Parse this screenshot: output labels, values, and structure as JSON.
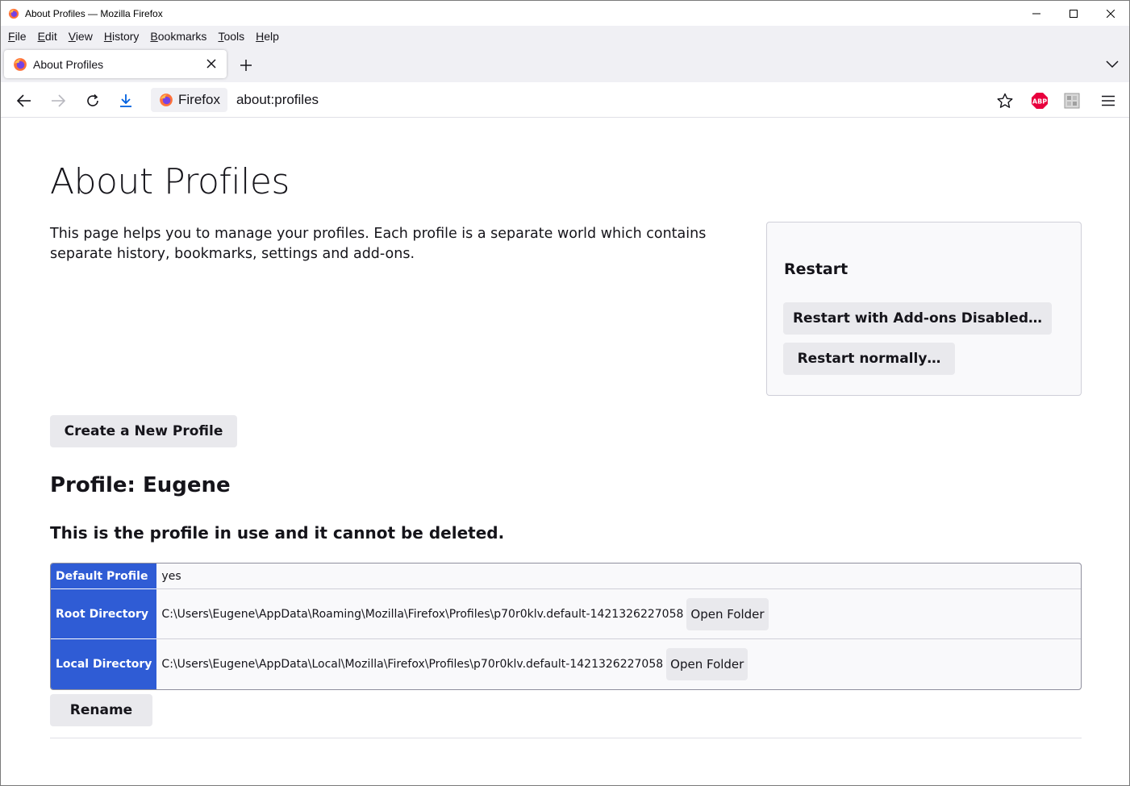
{
  "window": {
    "title": "About Profiles — Mozilla Firefox"
  },
  "menubar": {
    "items": [
      {
        "label": "File",
        "accel": "F",
        "rest": "ile"
      },
      {
        "label": "Edit",
        "accel": "E",
        "rest": "dit"
      },
      {
        "label": "View",
        "accel": "V",
        "rest": "iew"
      },
      {
        "label": "History",
        "accel": "H",
        "rest": "istory"
      },
      {
        "label": "Bookmarks",
        "accel": "B",
        "rest": "ookmarks"
      },
      {
        "label": "Tools",
        "accel": "T",
        "rest": "ools"
      },
      {
        "label": "Help",
        "accel": "H",
        "rest": "elp"
      }
    ]
  },
  "tabs": {
    "active_title": "About Profiles"
  },
  "navbar": {
    "identity_label": "Firefox",
    "url": "about:profiles"
  },
  "page": {
    "title": "About Profiles",
    "intro": "This page helps you to manage your profiles. Each profile is a separate world which contains separate history, bookmarks, settings and add-ons.",
    "restart": {
      "heading": "Restart",
      "disabled_button": "Restart with Add-ons Disabled…",
      "normal_button": "Restart normally…"
    },
    "create_button": "Create a New Profile",
    "profile": {
      "name": "Profile: Eugene",
      "warning": "This is the profile in use and it cannot be deleted.",
      "rows": {
        "default_label": "Default Profile",
        "default_value": "yes",
        "root_label": "Root Directory",
        "root_value": "C:\\Users\\Eugene\\AppData\\Roaming\\Mozilla\\Firefox\\Profiles\\p70r0klv.default-1421326227058",
        "local_label": "Local Directory",
        "local_value": "C:\\Users\\Eugene\\AppData\\Local\\Mozilla\\Firefox\\Profiles\\p70r0klv.default-1421326227058",
        "open_folder": "Open Folder"
      },
      "rename_button": "Rename"
    }
  },
  "colors": {
    "accent_blue": "#2f5cd5",
    "abp_red": "#e8003d",
    "download_blue": "#0060df"
  }
}
